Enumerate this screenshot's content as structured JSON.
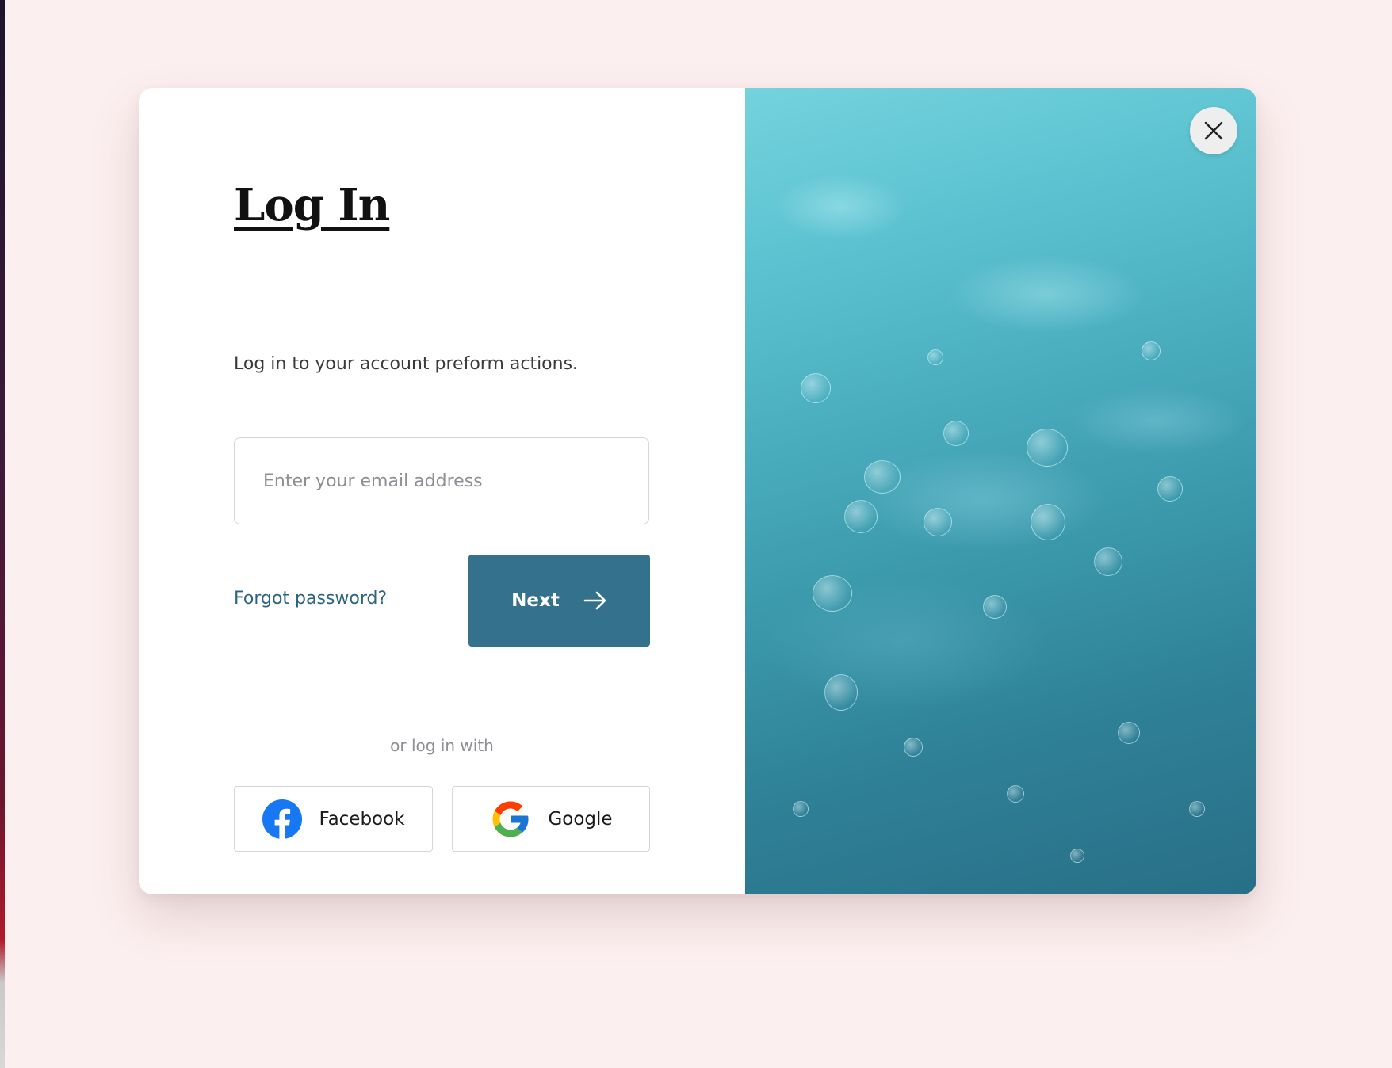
{
  "page": {
    "background_color": "#fcefef"
  },
  "login_modal": {
    "title": "Log In",
    "subtitle": "Log in to your account preform actions.",
    "email_placeholder": "Enter your email address",
    "email_value": "",
    "forgot_password_label": "Forgot password?",
    "next_label": "Next",
    "next_icon": "arrow-right-icon",
    "divider_text": "or log in with",
    "social": [
      {
        "label": "Facebook",
        "icon": "facebook-icon"
      },
      {
        "label": "Google",
        "icon": "google-icon"
      }
    ],
    "close_icon": "close-icon",
    "colors": {
      "primary": "#34718c",
      "link": "#2d6480",
      "muted_text": "#8c8f93"
    },
    "hero_image": "water-texture-image"
  }
}
